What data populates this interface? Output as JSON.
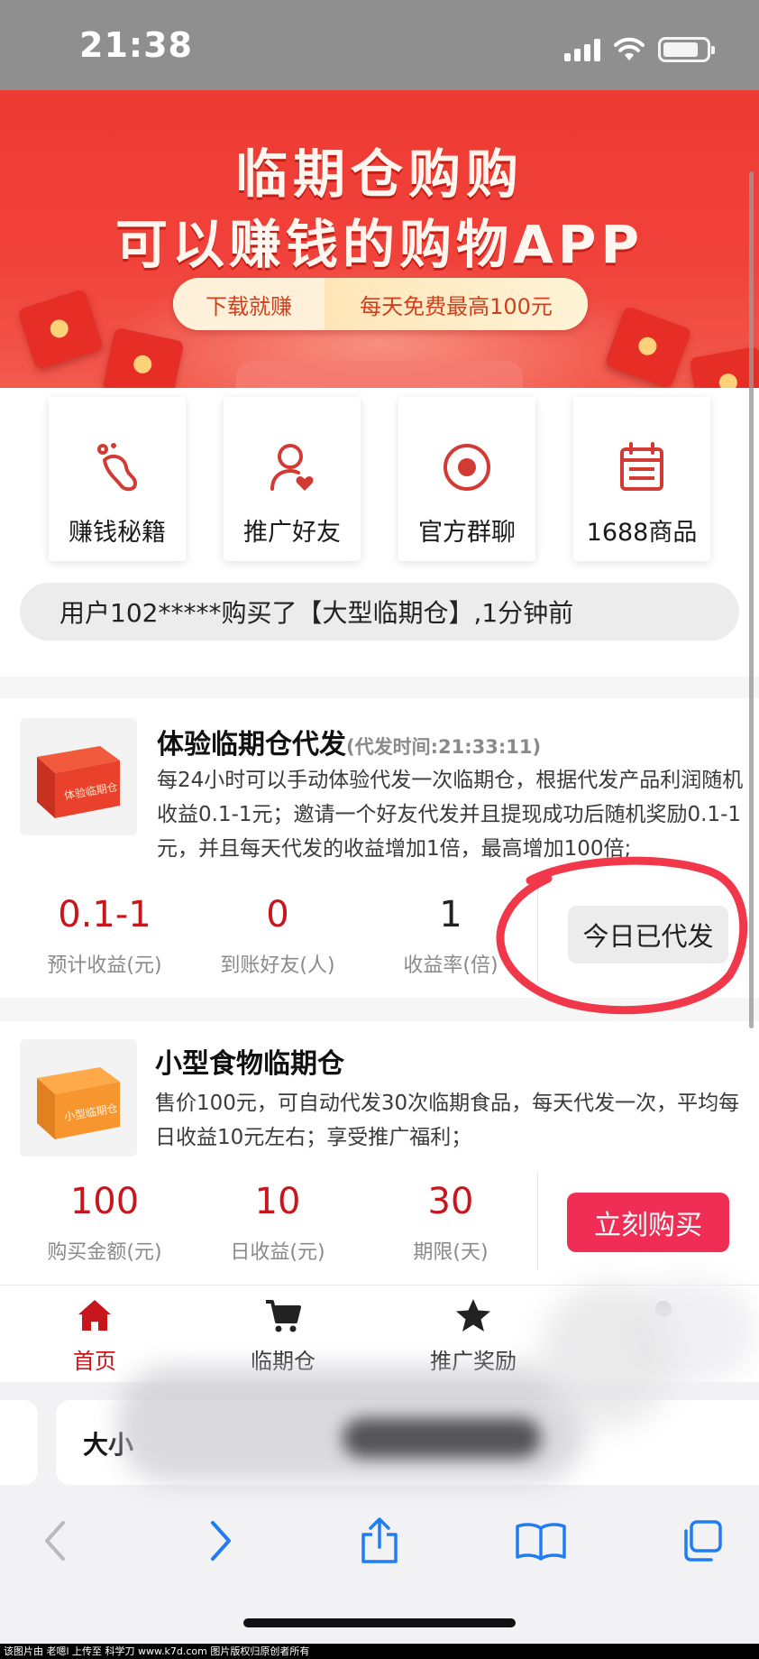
{
  "status_bar": {
    "time": "21:38"
  },
  "banner": {
    "title_line1": "临期仓购购",
    "title_line2": "可以赚钱的购物APP",
    "pill_left": "下载就赚",
    "pill_right": "每天免费最高100元"
  },
  "quick_menu": {
    "items": [
      {
        "label": "赚钱秘籍",
        "icon": "footprint-icon"
      },
      {
        "label": "推广好友",
        "icon": "user-heart-icon"
      },
      {
        "label": "官方群聊",
        "icon": "target-icon"
      },
      {
        "label": "1688商品",
        "icon": "calendar-list-icon"
      }
    ]
  },
  "ticker": {
    "text": "用户102*****购买了【大型临期仓】,1分钟前"
  },
  "products": [
    {
      "title": "体验临期仓代发",
      "subtitle": "(代发时间:21:33:11)",
      "box_label": "体验临期仓",
      "description": "每24小时可以手动体验代发一次临期仓，根据代发产品利润随机收益0.1-1元；邀请一个好友代发并且提现成功后随机奖励0.1-1元，并且每天代发的收益增加1倍，最高增加100倍;",
      "stats": [
        {
          "value": "0.1-1",
          "label": "预计收益(元)"
        },
        {
          "value": "0",
          "label": "到账好友(人)"
        },
        {
          "value": "1",
          "label": "收益率(倍)"
        }
      ],
      "button": "今日已代发"
    },
    {
      "title": "小型食物临期仓",
      "box_label": "小型临期仓",
      "description": "售价100元，可自动代发30次临期食品，每天代发一次，平均每日收益10元左右；享受推广福利；",
      "stats": [
        {
          "value": "100",
          "label": "购买金额(元)"
        },
        {
          "value": "10",
          "label": "日收益(元)"
        },
        {
          "value": "30",
          "label": "期限(天)"
        }
      ],
      "button": "立刻购买"
    }
  ],
  "tabbar": {
    "items": [
      {
        "label": "首页",
        "icon": "home-icon",
        "active": true
      },
      {
        "label": "临期仓",
        "icon": "cart-icon",
        "active": false
      },
      {
        "label": "推广奖励",
        "icon": "star-icon",
        "active": false
      }
    ]
  },
  "safari": {
    "address_text": "大小"
  },
  "footer": {
    "text": "该图片由 老嗯l 上传至 科学刀 www.k7d.com 图片版权归原创者所有"
  },
  "colors": {
    "brand_red": "#ee3b33",
    "value_red": "#c8161d",
    "buy_pink": "#ef2d55",
    "ios_blue": "#1f7cf2"
  }
}
